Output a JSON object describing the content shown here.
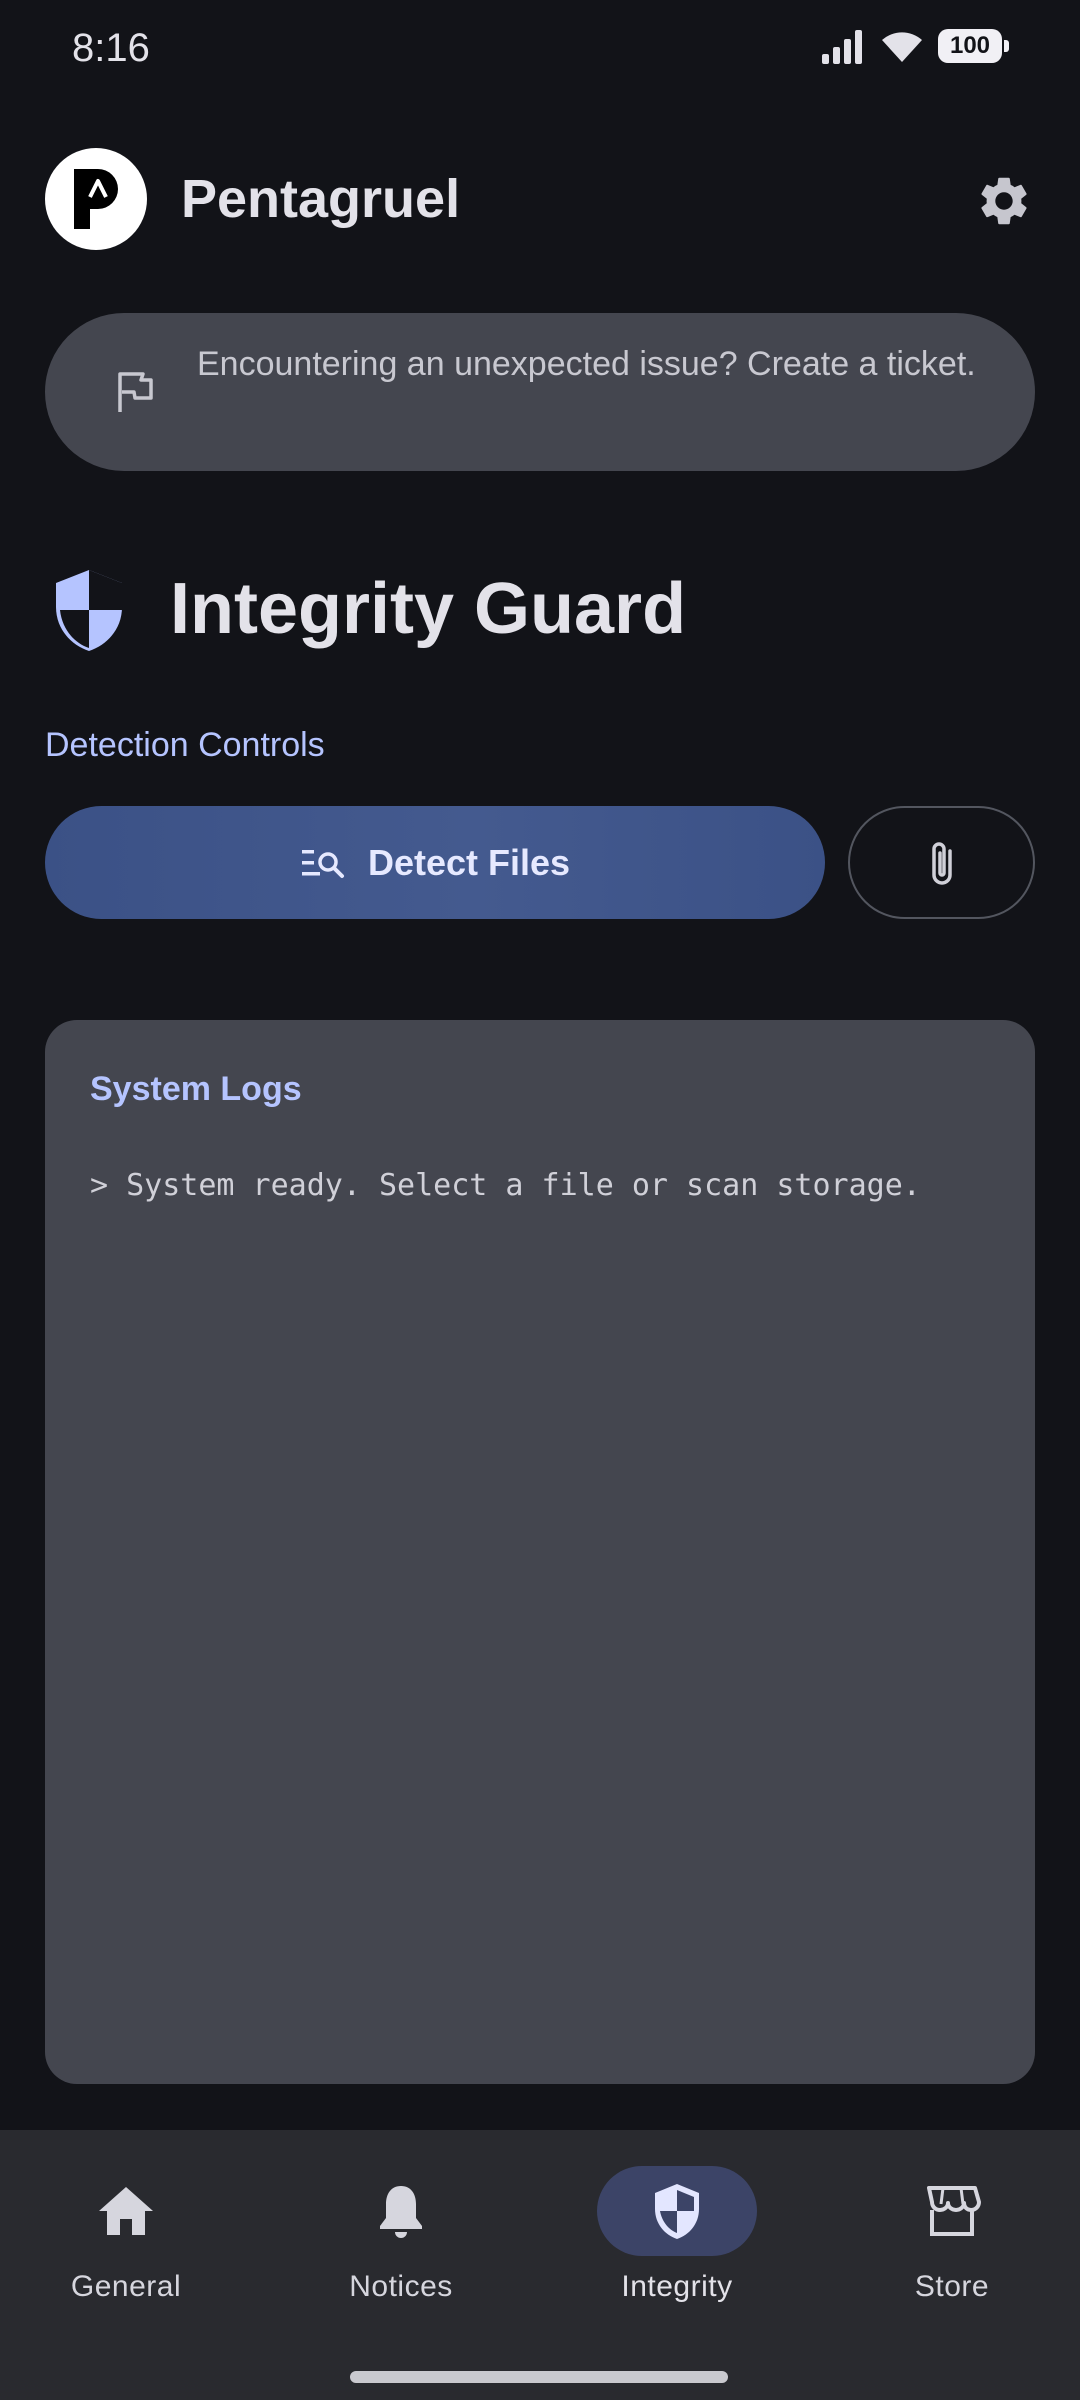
{
  "status_bar": {
    "time": "8:16",
    "battery": "100"
  },
  "header": {
    "app_title": "Pentagruel",
    "logo_letter": "P"
  },
  "ticket_banner": {
    "text": "Encountering an unexpected issue? Create a ticket."
  },
  "page": {
    "title": "Integrity Guard",
    "section_label": "Detection Controls",
    "detect_button_label": "Detect Files"
  },
  "logs": {
    "title": "System Logs",
    "lines": [
      "> System ready. Select a file or scan storage."
    ]
  },
  "bottom_nav": {
    "items": [
      {
        "label": "General",
        "icon": "home-icon"
      },
      {
        "label": "Notices",
        "icon": "bell-icon"
      },
      {
        "label": "Integrity",
        "icon": "shield-icon",
        "active": true
      },
      {
        "label": "Store",
        "icon": "storefront-icon"
      }
    ]
  },
  "colors": {
    "background": "#121318",
    "surface": "#44464f",
    "accent": "#b5c4ff",
    "primary_button": "#3f558a",
    "nav_background": "#292a2f"
  }
}
